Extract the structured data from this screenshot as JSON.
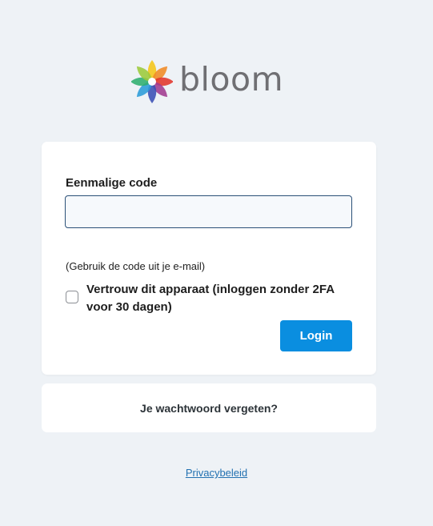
{
  "brand": {
    "name": "bloom",
    "petal_colors": [
      "#f5c518",
      "#f08a24",
      "#e2342b",
      "#a03a8f",
      "#3a4fb5",
      "#2a9bd8",
      "#2fae6e",
      "#9cc93a"
    ]
  },
  "form": {
    "code_label": "Eenmalige code",
    "code_value": "",
    "hint": "(Gebruik de code uit je e-mail)",
    "trust_label": "Vertrouw dit apparaat (inloggen zonder 2FA voor 30 dagen)",
    "trust_checked": false,
    "login_label": "Login"
  },
  "links": {
    "forgot_password": "Je wachtwoord vergeten?",
    "privacy": "Privacybeleid"
  },
  "colors": {
    "background": "#eef2f6",
    "primary_button": "#0a8ee0",
    "link": "#2271b1"
  }
}
